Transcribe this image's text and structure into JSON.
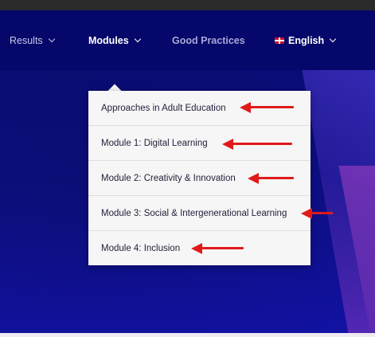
{
  "nav": {
    "results_label": "Results",
    "modules_label": "Modules",
    "good_practices_label": "Good Practices",
    "language_label": "English"
  },
  "dropdown": {
    "items": [
      {
        "label": "Approaches in Adult Education"
      },
      {
        "label": "Module 1: Digital Learning"
      },
      {
        "label": "Module 2: Creativity & Innovation"
      },
      {
        "label": "Module 3: Social & Intergenerational Learning"
      },
      {
        "label": "Module 4: Inclusion"
      }
    ]
  },
  "colors": {
    "nav_background": "#05076a",
    "hero_background": "#0e0f8c",
    "annotation_arrow": "#e01a1a"
  },
  "icons": {
    "dropdown_chevron": "chevron-down-icon",
    "language_flag": "uk-flag-icon",
    "annotation": "red-arrow-icon"
  }
}
